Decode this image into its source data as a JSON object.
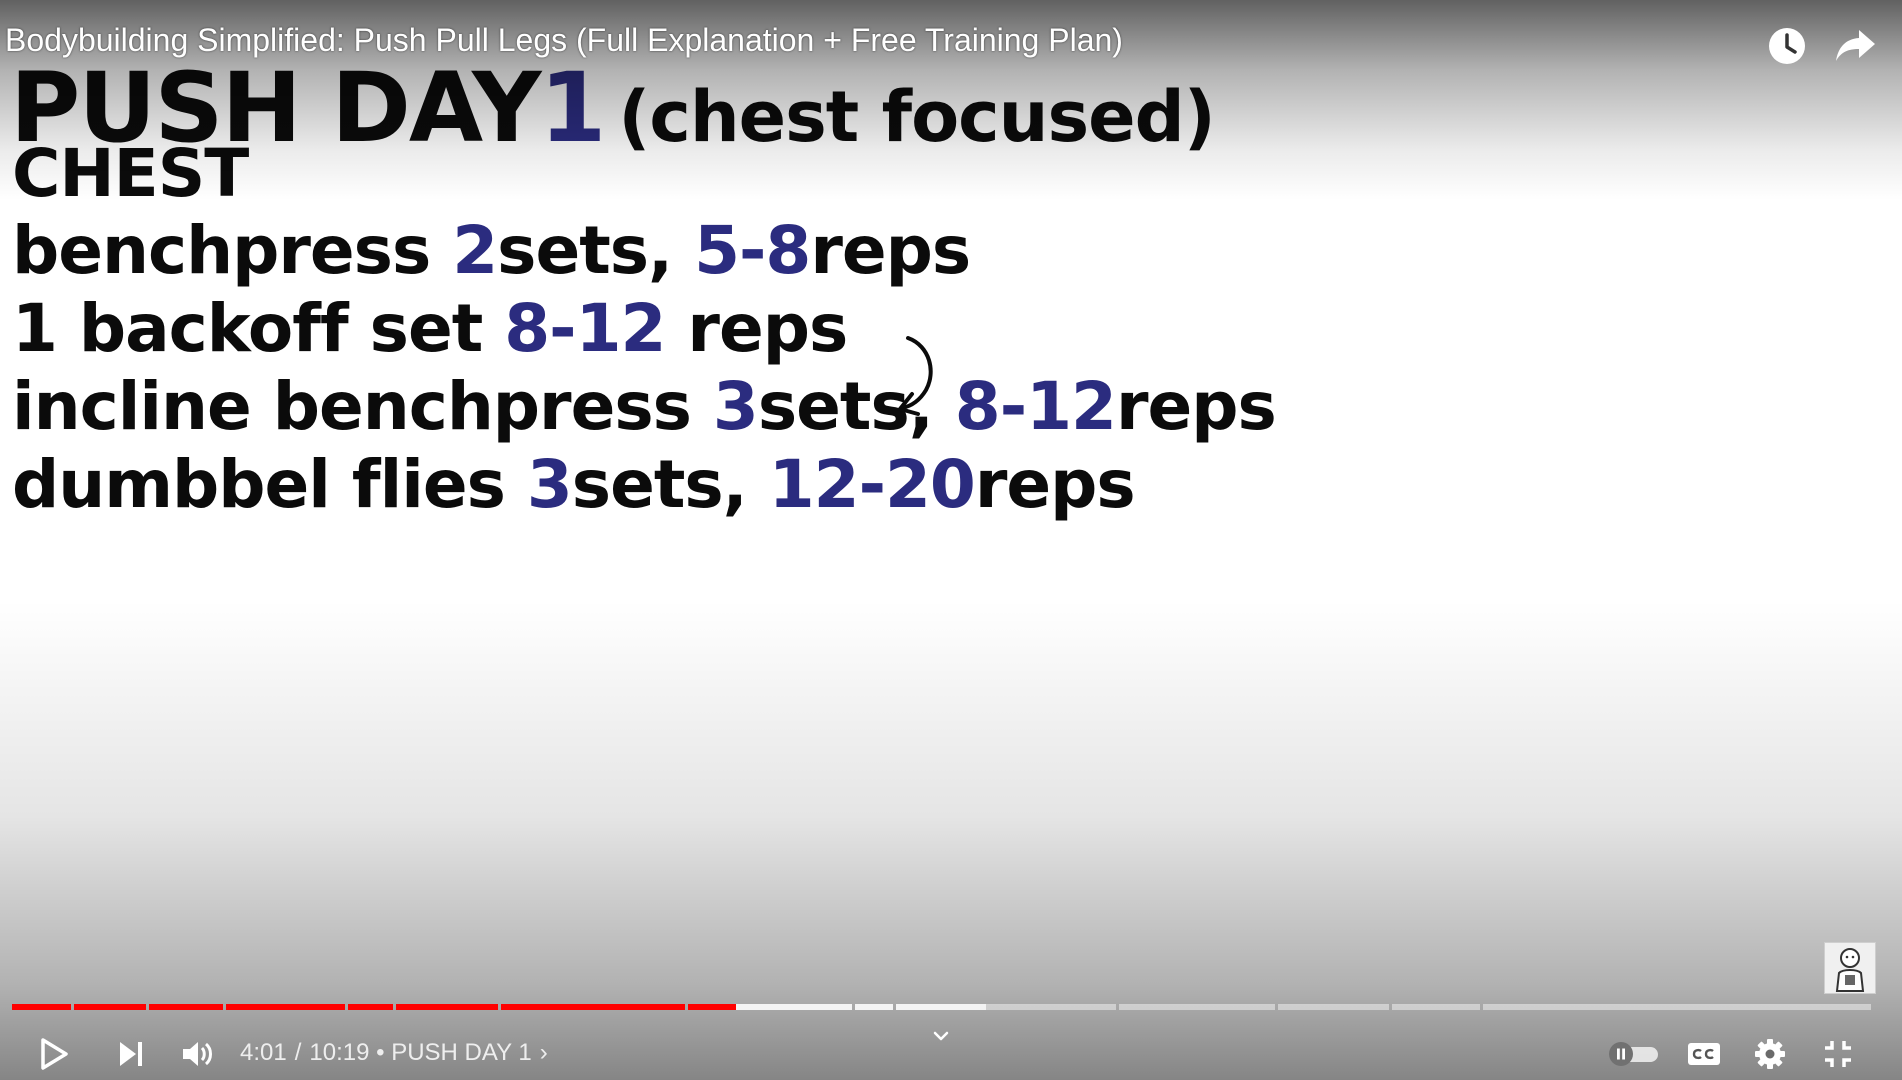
{
  "video": {
    "title": "Bodybuilding Simplified: Push Pull Legs (Full Explanation + Free Training Plan)"
  },
  "slide": {
    "heading": {
      "text": "PUSH DAY",
      "number": "1",
      "focus": "(chest focused)"
    },
    "section": "CHEST",
    "lines": [
      {
        "a": "benchpress ",
        "b": "2",
        "c": "sets, ",
        "d": "5-8",
        "e": "reps"
      },
      {
        "a": "1 backoff set ",
        "b": "8-12",
        "c": " reps"
      },
      {
        "a": "incline benchpress ",
        "b": "3",
        "c": "sets, ",
        "d": "8-12",
        "e": "reps"
      },
      {
        "a": "dumbbel flies ",
        "b": "3",
        "c": "sets, ",
        "d": "12-20",
        "e": "reps"
      }
    ]
  },
  "player": {
    "current_time": "4:01",
    "duration": "10:19",
    "separator": "/",
    "chapter_bullet": "•",
    "chapter": "PUSH DAY 1",
    "chapter_chevron": "›",
    "progress_fraction": 0.389,
    "colors": {
      "played": "#ff0000",
      "accent_text": "#2b2c7f"
    },
    "icons": [
      "play-icon",
      "next-icon",
      "volume-icon",
      "chevron-down-icon",
      "autoplay-toggle-icon",
      "captions-icon",
      "settings-icon",
      "exit-fullscreen-icon",
      "watch-later-icon",
      "share-icon"
    ]
  }
}
